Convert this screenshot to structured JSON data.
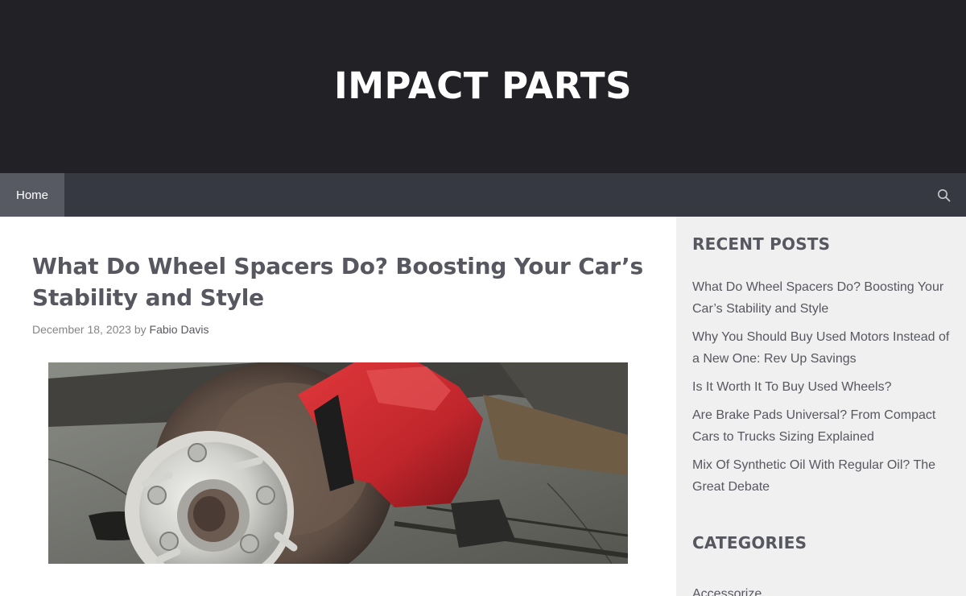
{
  "site": {
    "title": "IMPACT PARTS"
  },
  "nav": {
    "items": [
      {
        "label": "Home"
      }
    ],
    "search_icon": "search-icon"
  },
  "post": {
    "title": "What Do Wheel Spacers Do? Boosting Your Car’s Stability and Style",
    "date": "December 18, 2023",
    "by": "by",
    "author": "Fabio Davis",
    "image_alt": "featured-image-wheel-spacer-brake-caliper"
  },
  "sidebar": {
    "recent_title": "RECENT POSTS",
    "recent_posts": [
      "What Do Wheel Spacers Do? Boosting Your Car’s Stability and Style",
      "Why You Should Buy Used Motors Instead of a New One: Rev Up Savings",
      "Is It Worth It To Buy Used Wheels?",
      "Are Brake Pads Universal? From Compact Cars to Trucks Sizing Explained",
      "Mix Of Synthetic Oil With Regular Oil? The Great Debate"
    ],
    "categories_title": "CATEGORIES",
    "categories": [
      "Accessorize"
    ]
  },
  "colors": {
    "header_bg": "#222226",
    "nav_bg": "#363842",
    "nav_active_bg": "#585a63",
    "text": "#575760",
    "sidebar_bg": "#f0f0f0",
    "caliper_red": "#c0262c"
  }
}
